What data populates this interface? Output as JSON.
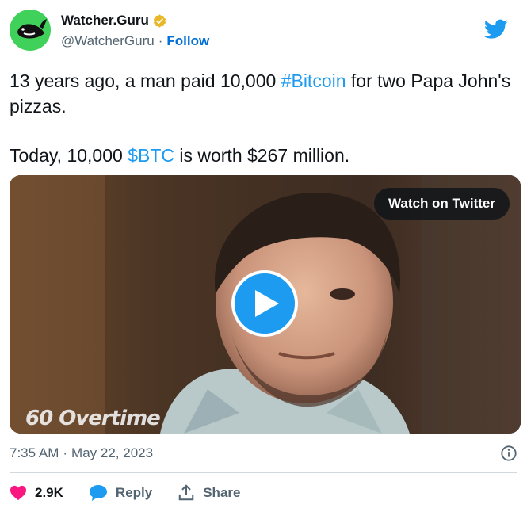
{
  "author": {
    "name": "Watcher.Guru",
    "handle": "@WatcherGuru",
    "separator": "·",
    "follow_label": "Follow",
    "avatar_color": "#3fd15a"
  },
  "tweet": {
    "line1_prefix": "13 years ago, a man paid 10,000 ",
    "line1_hashtag": "#Bitcoin",
    "line1_suffix": " for two Papa John's pizzas.",
    "line2_prefix": "Today, 10,000 ",
    "line2_cashtag": "$BTC",
    "line2_suffix": " is worth $267 million."
  },
  "media": {
    "watch_label": "Watch on Twitter",
    "watermark": "60 Overtime",
    "play_color": "#1d9bf0"
  },
  "meta": {
    "time": "7:35 AM",
    "separator": "·",
    "date": "May 22, 2023"
  },
  "actions": {
    "likes": "2.9K",
    "reply_label": "Reply",
    "share_label": "Share"
  },
  "colors": {
    "link": "#1d9bf0",
    "like": "#f91880",
    "follow": "#006fd6",
    "secondary_text": "#536471"
  }
}
